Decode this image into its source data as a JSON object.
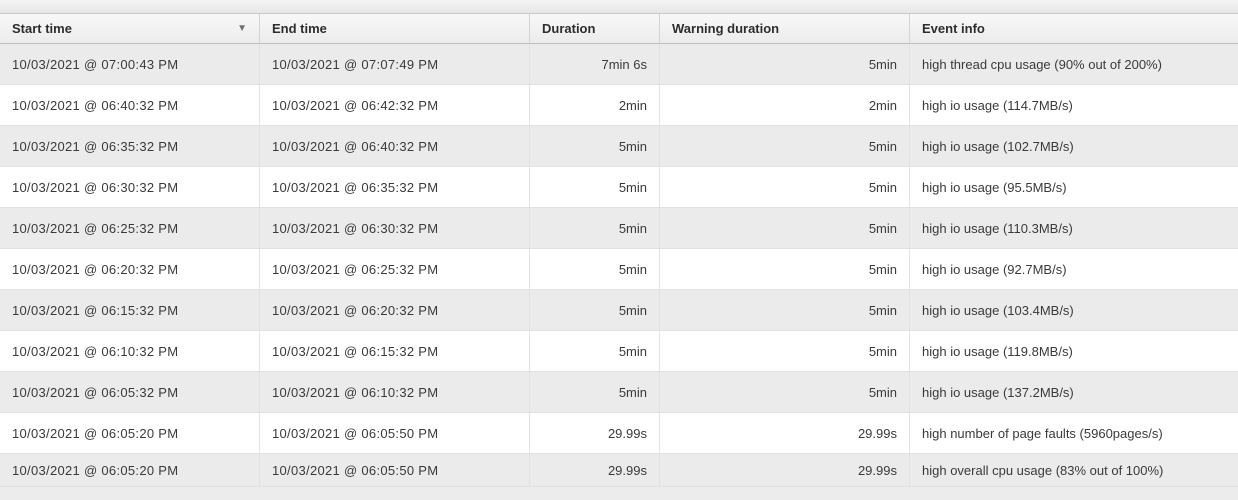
{
  "columns": {
    "start_time": "Start time",
    "end_time": "End time",
    "duration": "Duration",
    "warning_duration": "Warning duration",
    "event_info": "Event info"
  },
  "sort": {
    "column": "start_time",
    "direction": "desc"
  },
  "rows": [
    {
      "start_time": "10/03/2021 @ 07:00:43 PM",
      "end_time": "10/03/2021 @ 07:07:49 PM",
      "duration": "7min 6s",
      "warning_duration": "5min",
      "event_info": "high thread cpu usage (90% out of 200%)"
    },
    {
      "start_time": "10/03/2021 @ 06:40:32 PM",
      "end_time": "10/03/2021 @ 06:42:32 PM",
      "duration": "2min",
      "warning_duration": "2min",
      "event_info": "high io usage (114.7MB/s)"
    },
    {
      "start_time": "10/03/2021 @ 06:35:32 PM",
      "end_time": "10/03/2021 @ 06:40:32 PM",
      "duration": "5min",
      "warning_duration": "5min",
      "event_info": "high io usage (102.7MB/s)"
    },
    {
      "start_time": "10/03/2021 @ 06:30:32 PM",
      "end_time": "10/03/2021 @ 06:35:32 PM",
      "duration": "5min",
      "warning_duration": "5min",
      "event_info": "high io usage (95.5MB/s)"
    },
    {
      "start_time": "10/03/2021 @ 06:25:32 PM",
      "end_time": "10/03/2021 @ 06:30:32 PM",
      "duration": "5min",
      "warning_duration": "5min",
      "event_info": "high io usage (110.3MB/s)"
    },
    {
      "start_time": "10/03/2021 @ 06:20:32 PM",
      "end_time": "10/03/2021 @ 06:25:32 PM",
      "duration": "5min",
      "warning_duration": "5min",
      "event_info": "high io usage (92.7MB/s)"
    },
    {
      "start_time": "10/03/2021 @ 06:15:32 PM",
      "end_time": "10/03/2021 @ 06:20:32 PM",
      "duration": "5min",
      "warning_duration": "5min",
      "event_info": "high io usage (103.4MB/s)"
    },
    {
      "start_time": "10/03/2021 @ 06:10:32 PM",
      "end_time": "10/03/2021 @ 06:15:32 PM",
      "duration": "5min",
      "warning_duration": "5min",
      "event_info": "high io usage (119.8MB/s)"
    },
    {
      "start_time": "10/03/2021 @ 06:05:32 PM",
      "end_time": "10/03/2021 @ 06:10:32 PM",
      "duration": "5min",
      "warning_duration": "5min",
      "event_info": "high io usage (137.2MB/s)"
    },
    {
      "start_time": "10/03/2021 @ 06:05:20 PM",
      "end_time": "10/03/2021 @ 06:05:50 PM",
      "duration": "29.99s",
      "warning_duration": "29.99s",
      "event_info": "high number of page faults (5960pages/s)"
    },
    {
      "start_time": "10/03/2021 @ 06:05:20 PM",
      "end_time": "10/03/2021 @ 06:05:50 PM",
      "duration": "29.99s",
      "warning_duration": "29.99s",
      "event_info": "high overall cpu usage (83% out of 100%)"
    }
  ]
}
